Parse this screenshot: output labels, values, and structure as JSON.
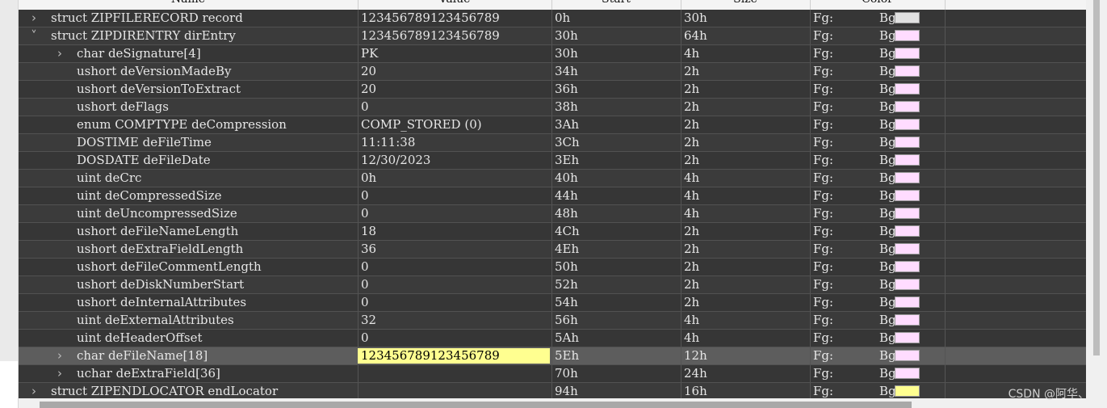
{
  "columns": {
    "name": "Name",
    "value": "Value",
    "start": "Start",
    "size": "Size",
    "color": "Color"
  },
  "fg_label": "Fg:",
  "bg_label": "Bg:",
  "watermark": "CSDN @阿华、",
  "rows": [
    {
      "name": "struct ZIPFILERECORD record",
      "value": "123456789123456789",
      "start": "0h",
      "size": "30h",
      "bg": "#e1e1e1",
      "expander": "collapsed",
      "indent": 0
    },
    {
      "name": "struct ZIPDIRENTRY dirEntry",
      "value": "123456789123456789",
      "start": "30h",
      "size": "64h",
      "bg": "#ffdcff",
      "expander": "expanded",
      "indent": 0
    },
    {
      "name": "char deSignature[4]",
      "value": "PK",
      "start": "30h",
      "size": "4h",
      "bg": "#ffdcff",
      "expander": "collapsed",
      "indent": 1
    },
    {
      "name": "ushort deVersionMadeBy",
      "value": "20",
      "start": "34h",
      "size": "2h",
      "bg": "#ffdcff",
      "expander": "none",
      "indent": 1
    },
    {
      "name": "ushort deVersionToExtract",
      "value": "20",
      "start": "36h",
      "size": "2h",
      "bg": "#ffdcff",
      "expander": "none",
      "indent": 1
    },
    {
      "name": "ushort deFlags",
      "value": "0",
      "start": "38h",
      "size": "2h",
      "bg": "#ffdcff",
      "expander": "none",
      "indent": 1
    },
    {
      "name": "enum COMPTYPE deCompression",
      "value": "COMP_STORED (0)",
      "start": "3Ah",
      "size": "2h",
      "bg": "#ffdcff",
      "expander": "none",
      "indent": 1
    },
    {
      "name": "DOSTIME deFileTime",
      "value": "11:11:38",
      "start": "3Ch",
      "size": "2h",
      "bg": "#ffdcff",
      "expander": "none",
      "indent": 1
    },
    {
      "name": "DOSDATE deFileDate",
      "value": "12/30/2023",
      "start": "3Eh",
      "size": "2h",
      "bg": "#ffdcff",
      "expander": "none",
      "indent": 1
    },
    {
      "name": "uint deCrc",
      "value": "0h",
      "start": "40h",
      "size": "4h",
      "bg": "#ffdcff",
      "expander": "none",
      "indent": 1
    },
    {
      "name": "uint deCompressedSize",
      "value": "0",
      "start": "44h",
      "size": "4h",
      "bg": "#ffdcff",
      "expander": "none",
      "indent": 1
    },
    {
      "name": "uint deUncompressedSize",
      "value": "0",
      "start": "48h",
      "size": "4h",
      "bg": "#ffdcff",
      "expander": "none",
      "indent": 1
    },
    {
      "name": "ushort deFileNameLength",
      "value": "18",
      "start": "4Ch",
      "size": "2h",
      "bg": "#ffdcff",
      "expander": "none",
      "indent": 1
    },
    {
      "name": "ushort deExtraFieldLength",
      "value": "36",
      "start": "4Eh",
      "size": "2h",
      "bg": "#ffdcff",
      "expander": "none",
      "indent": 1
    },
    {
      "name": "ushort deFileCommentLength",
      "value": "0",
      "start": "50h",
      "size": "2h",
      "bg": "#ffdcff",
      "expander": "none",
      "indent": 1
    },
    {
      "name": "ushort deDiskNumberStart",
      "value": "0",
      "start": "52h",
      "size": "2h",
      "bg": "#ffdcff",
      "expander": "none",
      "indent": 1
    },
    {
      "name": "ushort deInternalAttributes",
      "value": "0",
      "start": "54h",
      "size": "2h",
      "bg": "#ffdcff",
      "expander": "none",
      "indent": 1
    },
    {
      "name": "uint deExternalAttributes",
      "value": "32",
      "start": "56h",
      "size": "4h",
      "bg": "#ffdcff",
      "expander": "none",
      "indent": 1
    },
    {
      "name": "uint deHeaderOffset",
      "value": "0",
      "start": "5Ah",
      "size": "4h",
      "bg": "#ffdcff",
      "expander": "none",
      "indent": 1
    },
    {
      "name": "char deFileName[18]",
      "value": "123456789123456789",
      "start": "5Eh",
      "size": "12h",
      "bg": "#ffdcff",
      "expander": "collapsed",
      "indent": 1,
      "selected": true
    },
    {
      "name": "uchar deExtraField[36]",
      "value": "",
      "start": "70h",
      "size": "24h",
      "bg": "#ffdcff",
      "expander": "collapsed",
      "indent": 1
    },
    {
      "name": "struct ZIPENDLOCATOR endLocator",
      "value": "",
      "start": "94h",
      "size": "16h",
      "bg": "#ffff90",
      "expander": "collapsed",
      "indent": 0
    }
  ]
}
